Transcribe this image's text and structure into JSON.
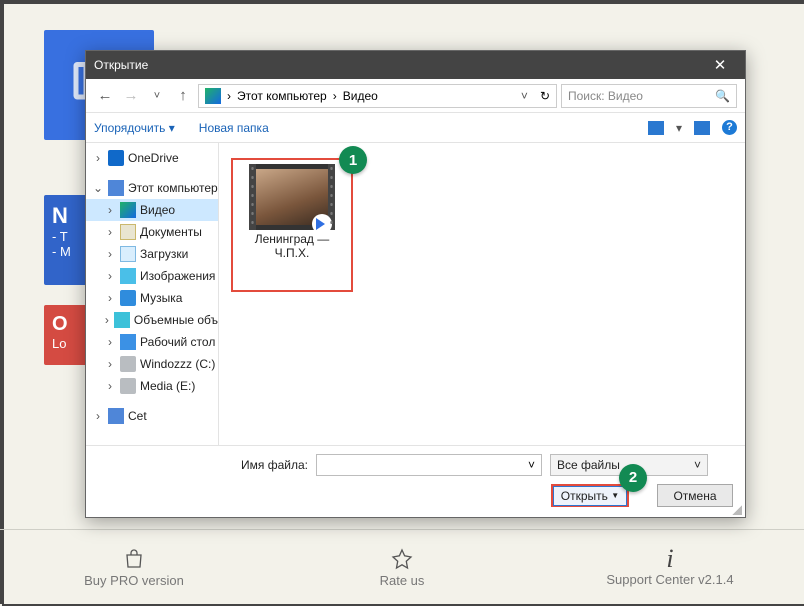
{
  "background": {
    "blue_sm_title": "N",
    "blue_sm_l1": "- T",
    "blue_sm_l2": "- M",
    "red_title": "O",
    "red_l1": "Lo"
  },
  "footer": {
    "buy": "Buy PRO version",
    "rate": "Rate us",
    "support": "Support Center  v2.1.4"
  },
  "dialog": {
    "title": "Открытие",
    "breadcrumb": {
      "pc": "Этот компьютер",
      "folder": "Видео"
    },
    "search_placeholder": "Поиск: Видео",
    "toolbar": {
      "organize": "Упорядочить",
      "newFolder": "Новая папка"
    },
    "tree": {
      "onedrive": "OneDrive",
      "pc": "Этот компьютер",
      "video": "Видео",
      "docs": "Документы",
      "downloads": "Загрузки",
      "images": "Изображения",
      "music": "Музыка",
      "objects3d": "Объемные объ",
      "desktop": "Рабочий стол",
      "cdrive": "Windozzz (C:)",
      "edrive": "Media (E:)",
      "net": "Сet"
    },
    "file": {
      "line1": "Ленинград —",
      "line2": "Ч.П.Х."
    },
    "callout1": "1",
    "callout2": "2",
    "filenameLabel": "Имя файла:",
    "filter": "Все файлы",
    "open": "Открыть",
    "cancel": "Отмена"
  }
}
